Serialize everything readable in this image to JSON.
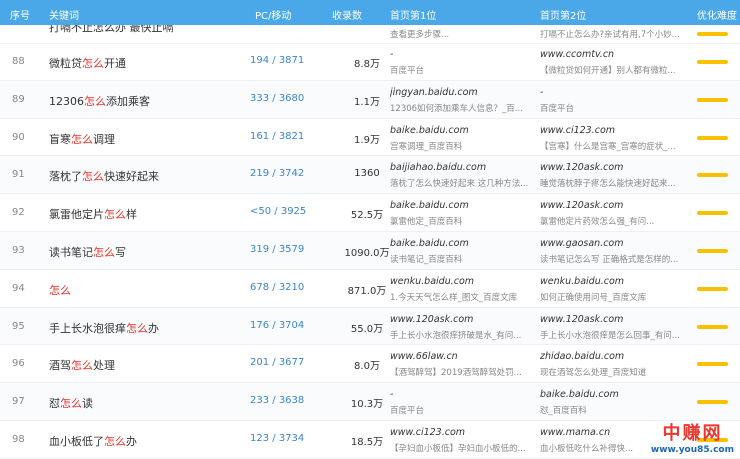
{
  "header": {
    "col_num": "序号",
    "col_kw": "关键词",
    "col_pc": "PC/移动",
    "col_vol": "收录数",
    "col_d1": "首页第1位",
    "col_d2": "首页第2位",
    "col_opt": "优化难度"
  },
  "partial_row": {
    "kw": "打嗝不止怎么办 最快止嗝",
    "t1": "查看更多步骤...",
    "t2": "打嗝不止怎么办?亲试有用,7个小妙..."
  },
  "rows": [
    {
      "num": "88",
      "kw_pre": "微粒贷",
      "kw_hl": "怎么",
      "kw_post": "开通",
      "pc": "194 / 3871",
      "vol": "8.8万",
      "d1": "-",
      "t1": "百度平台",
      "d2": "www.ccomtv.cn",
      "t2": "【微粒贷如何开通】别人都有微粒..."
    },
    {
      "num": "89",
      "kw_pre": "12306",
      "kw_hl": "怎么",
      "kw_post": "添加乘客",
      "pc": "333 / 3680",
      "vol": "1.1万",
      "d1": "jingyan.baidu.com",
      "t1": "12306如何添加乘车人信息？_百...",
      "d2": "-",
      "t2": "百度平台"
    },
    {
      "num": "90",
      "kw_pre": "盲寒",
      "kw_hl": "怎么",
      "kw_post": "调理",
      "pc": "161 / 3821",
      "vol": "1.9万",
      "d1": "baike.baidu.com",
      "t1": "宫寒调理_百度百科",
      "d2": "www.ci123.com",
      "t2": "【宫寒】什么是宫寒_宫寒的症状_..."
    },
    {
      "num": "91",
      "kw_pre": "落枕了",
      "kw_hl": "怎么",
      "kw_post": "快速好起来",
      "pc": "219 / 3742",
      "vol": "1360",
      "d1": "baijiahao.baidu.com",
      "t1": "落枕了怎么快速好起来 这几种方法...",
      "d2": "www.120ask.com",
      "t2": "睡觉落枕脖子疼怎么能快速好起来..."
    },
    {
      "num": "92",
      "kw_pre": "氯雷他定片",
      "kw_hl": "怎么",
      "kw_post": "样",
      "pc": "<50 / 3925",
      "vol": "52.5万",
      "d1": "baike.baidu.com",
      "t1": "氯雷他定_百度百科",
      "d2": "www.120ask.com",
      "t2": "氯雷他定片药效怎么强_有问..."
    },
    {
      "num": "93",
      "kw_pre": "读书笔记",
      "kw_hl": "怎么",
      "kw_post": "写",
      "pc": "319 / 3579",
      "vol": "1090.0万",
      "d1": "baike.baidu.com",
      "t1": "读书笔记_百度百科",
      "d2": "www.gaosan.com",
      "t2": "读书笔记怎么写 正确格式是怎样的..."
    },
    {
      "num": "94",
      "kw_pre": "",
      "kw_hl": "怎么",
      "kw_post": "",
      "pc": "678 / 3210",
      "vol": "871.0万",
      "d1": "wenku.baidu.com",
      "t1": "1.今天天气怎么样_图文_百度文库",
      "d2": "wenku.baidu.com",
      "t2": "如何正确使用问号_百度文库"
    },
    {
      "num": "95",
      "kw_pre": "手上长水泡很痒",
      "kw_hl": "怎么",
      "kw_post": "办",
      "pc": "176 / 3704",
      "vol": "55.0万",
      "d1": "www.120ask.com",
      "t1": "手上长小水泡很痒挤破是水_有问...",
      "d2": "www.120ask.com",
      "t2": "手上长小水泡很痒是怎么回事_有问..."
    },
    {
      "num": "96",
      "kw_pre": "酒驾",
      "kw_hl": "怎么",
      "kw_post": "处理",
      "pc": "201 / 3677",
      "vol": "8.0万",
      "d1": "www.66law.cn",
      "t1": "【酒驾醉驾】2019酒驾醉驾处罚...",
      "d2": "zhidao.baidu.com",
      "t2": "现在酒驾怎么处理_百度知道"
    },
    {
      "num": "97",
      "kw_pre": "怼",
      "kw_hl": "怎么",
      "kw_post": "读",
      "pc": "233 / 3638",
      "vol": "10.3万",
      "d1": "-",
      "t1": "百度平台",
      "d2": "baike.baidu.com",
      "t2": "怼_百度百科"
    },
    {
      "num": "98",
      "kw_pre": "血小板低了",
      "kw_hl": "怎么",
      "kw_post": "办",
      "pc": "123 / 3734",
      "vol": "18.5万",
      "d1": "www.ci123.com",
      "t1": "【孕妇血小板低】孕妇血小板低的...",
      "d2": "www.mama.cn",
      "t2": "血小板低吃什么补得快..."
    }
  ],
  "watermark": {
    "brand": "中赚网",
    "url": "www.you85.com"
  },
  "colors": {
    "header_bg": "#4aa8e8",
    "highlight": "#e8382f",
    "bar": "#f7c000"
  }
}
